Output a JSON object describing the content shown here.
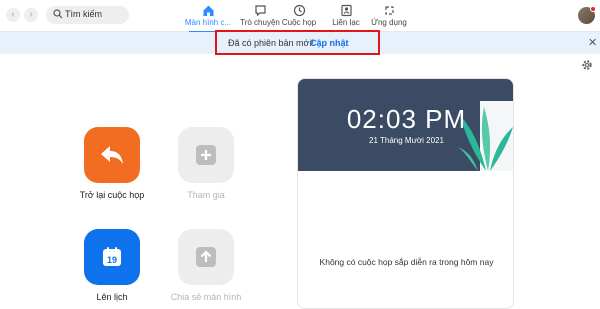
{
  "search": {
    "placeholder": "Tìm kiếm"
  },
  "tabs": [
    {
      "label": "Màn hình c...",
      "icon": "home-icon",
      "active": true
    },
    {
      "label": "Trò chuyện",
      "icon": "chat-icon",
      "active": false
    },
    {
      "label": "Cuộc họp",
      "icon": "clock-icon",
      "active": false
    },
    {
      "label": "Liên lạc",
      "icon": "contact-icon",
      "active": false
    },
    {
      "label": "Ứng dụng",
      "icon": "apps-icon",
      "active": false
    }
  ],
  "banner": {
    "message": "Đã có phiên bản mới!",
    "link": "Cập nhật"
  },
  "actions": [
    {
      "label": "Trở lại cuộc họp",
      "icon": "return-arrow-icon",
      "color": "#f26d21",
      "enabled": true
    },
    {
      "label": "Tham gia",
      "icon": "plus-icon",
      "color": "#ededed",
      "enabled": false
    },
    {
      "label": "Lên lịch",
      "icon": "calendar-icon",
      "color": "#0e72ed",
      "enabled": true,
      "calendar_day": "19"
    },
    {
      "label": "Chia sẻ màn hình",
      "icon": "share-upload-icon",
      "color": "#ededed",
      "enabled": false
    }
  ],
  "panel": {
    "time": "02:03 PM",
    "date": "21 Tháng Mười 2021",
    "empty_message": "Không có cuộc họp sắp diễn ra trong hôm nay"
  },
  "colors": {
    "accent": "#2d8cff",
    "banner_bg": "#e8f1fb",
    "hero_bg": "#3b4b63",
    "highlight_box": "#e0161b"
  }
}
